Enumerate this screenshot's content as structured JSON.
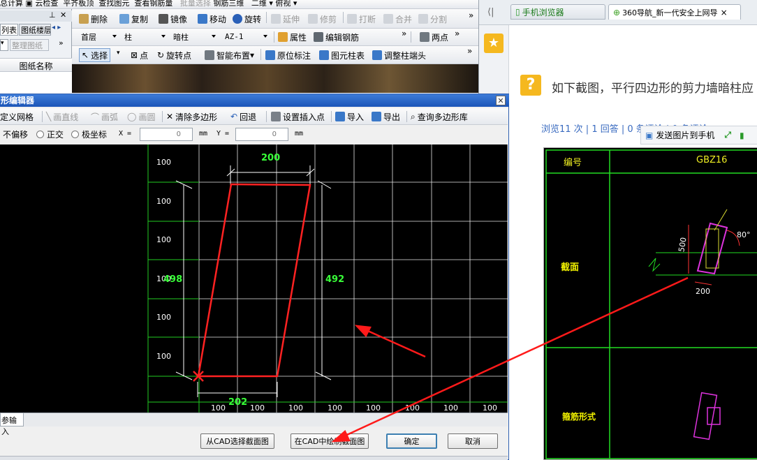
{
  "app": {
    "toolbar1": {
      "items": [
        "总计算",
        "云检查",
        "平齐板顶",
        "查找图元",
        "查看钢筋量",
        "批量选择",
        "钢筋三维",
        "二维",
        "俯视"
      ]
    },
    "panel_tabs": [
      "列表",
      "图纸楼层"
    ],
    "panel_button": "整理图纸",
    "panel_header": "图纸名称",
    "toolbar2": {
      "delete": "删除",
      "copy": "复制",
      "mirror": "镜像",
      "move": "移动",
      "rotate": "旋转",
      "extend": "延伸",
      "trim": "修剪",
      "break": "打断",
      "merge": "合并",
      "split": "分割"
    },
    "toolbar3": {
      "floor": "首层",
      "type": "柱",
      "subtype": "暗柱",
      "name": "AZ-1",
      "props": "属性",
      "edit_rebar": "编辑钢筋",
      "two_points": "两点"
    },
    "toolbar4": {
      "select": "选择",
      "point": "点",
      "rotate_point": "旋转点",
      "smart": "智能布置",
      "in_place": "原位标注",
      "column_table": "图元柱表",
      "adjust_end": "调整柱端头"
    }
  },
  "dialog": {
    "title": "形编辑器",
    "toolbar": {
      "define_grid": "定义网格",
      "draw_line": "画直线",
      "draw_arc": "画弧",
      "draw_circle": "画圆",
      "clear": "清除多边形",
      "undo": "回退",
      "set_insert": "设置插入点",
      "import": "导入",
      "export": "导出",
      "query": "查询多边形库"
    },
    "options": {
      "no_offset": "不偏移",
      "orthogonal": "正交",
      "polar": "极坐标",
      "x_label": "X =",
      "x_value": "0",
      "y_label": "Y =",
      "y_value": "0",
      "unit": "mm"
    },
    "grid_left": [
      "100",
      "100",
      "100",
      "100",
      "100",
      "100"
    ],
    "grid_bottom": [
      "100",
      "100",
      "100",
      "100",
      "100",
      "100",
      "100",
      "100"
    ],
    "dims": {
      "top": "200",
      "bottom": "202",
      "left": "498",
      "right": "492"
    },
    "status_tab": "参输入",
    "buttons": {
      "from_cad": "从CAD选择截面图",
      "draw_cad": "在CAD中绘制截面图",
      "ok": "确定",
      "cancel": "取消"
    }
  },
  "browser": {
    "tabs": [
      "手机浏览器",
      "360导航_新一代安全上网导"
    ],
    "question": "如下截图，平行四边形的剪力墙暗柱应",
    "stats": "浏览11 次 | 1 回答 | 0 条评论 | 0 条评论",
    "send_to_phone": "发送图片到手机",
    "table": {
      "col1": "编号",
      "col2": "GBZ16",
      "row_section": "截面",
      "row_stirrup": "箍筋形式",
      "dim_500": "500",
      "dim_200": "200",
      "angle": "80°"
    }
  }
}
